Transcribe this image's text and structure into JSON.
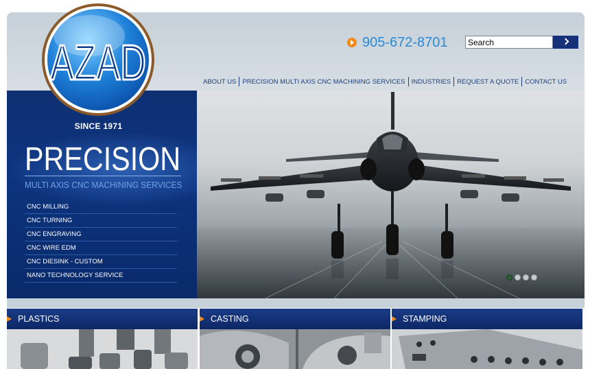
{
  "brand": {
    "logo_text": "AZAD",
    "since": "SINCE 1971"
  },
  "header": {
    "phone": "905-672-8701",
    "search": {
      "value": "Search"
    }
  },
  "nav": {
    "items": [
      {
        "label": "ABOUT US"
      },
      {
        "label": "PRECISION MULTI AXIS CNC MACHINING SERVICES"
      },
      {
        "label": "INDUSTRIES"
      },
      {
        "label": "REQUEST A QUOTE"
      },
      {
        "label": "CONTACT US"
      }
    ]
  },
  "hero_panel": {
    "title": "PRECISION",
    "subtitle": "MULTI AXIS CNC MACHINING SERVICES",
    "services": [
      {
        "label": "CNC MILLING"
      },
      {
        "label": "CNC TURNING"
      },
      {
        "label": "CNC ENGRAVING"
      },
      {
        "label": "CNC WIRE EDM"
      },
      {
        "label": "CNC DIESINK - CUSTOM"
      },
      {
        "label": "NANO TECHNOLOGY SERVICE"
      }
    ]
  },
  "slider": {
    "slide_count": 4,
    "active_index": 0
  },
  "categories": [
    {
      "label": "PLASTICS"
    },
    {
      "label": "CASTING"
    },
    {
      "label": "STAMPING"
    }
  ],
  "colors": {
    "navy": "#0d347f",
    "accent_orange": "#f08a1c",
    "phone_blue": "#2a8ad8",
    "header_gray": "#c6d0d8"
  }
}
